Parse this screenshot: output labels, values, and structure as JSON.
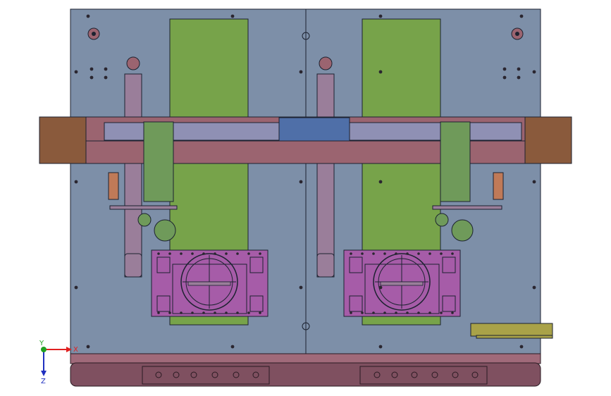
{
  "view": {
    "background": "#ffffff",
    "colors": {
      "plate": "#7d8fa8",
      "plate_edge": "#1c2230",
      "frame": "#9b6470",
      "frame_dark": "#7a4a56",
      "belt": "#77a34a",
      "block": "#8a5a3c",
      "window": "#8f90b4",
      "slot": "#4f6fa8",
      "motor": "#6f9a5a",
      "bracket": "#9a7e9a",
      "fixture": "#a65ca8",
      "bottom_rail": "#7f5060",
      "bottom_rail_light": "#a06a7a",
      "rail_outline": "#2a1a22",
      "holes": "#2a2630",
      "small_part": "#a9a248",
      "copper": "#c07a58"
    }
  },
  "triad": {
    "x_label": "X",
    "y_label": "Y",
    "z_label": "Z",
    "x_color": "#e02020",
    "y_color": "#20a020",
    "z_color": "#2030c0"
  }
}
